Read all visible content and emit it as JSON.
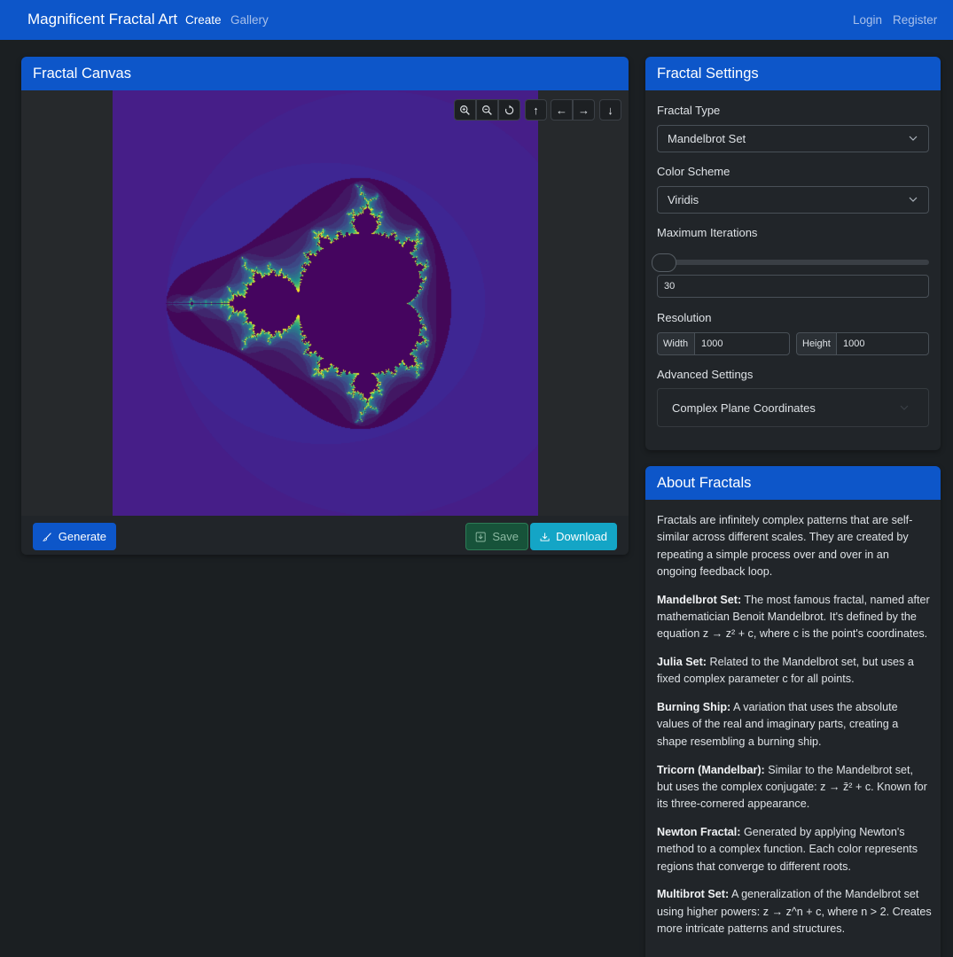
{
  "nav": {
    "brand": "Magnificent Fractal Art",
    "links": [
      {
        "label": "Create",
        "active": true
      },
      {
        "label": "Gallery",
        "active": false
      }
    ],
    "login": "Login",
    "register": "Register"
  },
  "canvas_card": {
    "title": "Fractal Canvas",
    "toolbar_icons": [
      "zoom-in-icon",
      "zoom-out-icon",
      "reset-icon",
      "arrow-up-icon",
      "arrow-left-icon",
      "arrow-right-icon",
      "arrow-down-icon"
    ],
    "toolbar_glyphs": {
      "up": "↑",
      "left": "←",
      "right": "→",
      "down": "↓"
    },
    "footer": {
      "generate_label": "Generate",
      "save_label": "Save",
      "download_label": "Download"
    }
  },
  "settings": {
    "title": "Fractal Settings",
    "fractal_type_label": "Fractal Type",
    "fractal_type_value": "Mandelbrot Set",
    "color_scheme_label": "Color Scheme",
    "color_scheme_value": "Viridis",
    "iterations_label": "Maximum Iterations",
    "iterations_value": "30",
    "iterations_slider_fraction": 0.0,
    "resolution_label": "Resolution",
    "width_label": "Width",
    "width_value": "1000",
    "height_label": "Height",
    "height_value": "1000",
    "advanced_label": "Advanced Settings",
    "accordion_label": "Complex Plane Coordinates"
  },
  "about": {
    "title": "About Fractals",
    "intro": "Fractals are infinitely complex patterns that are self-similar across different scales. They are created by repeating a simple process over and over in an ongoing feedback loop.",
    "entries": [
      {
        "term": "Mandelbrot Set:",
        "text": " The most famous fractal, named after mathematician Benoit Mandelbrot. It's defined by the equation z → z² + c, where c is the point's coordinates."
      },
      {
        "term": "Julia Set:",
        "text": " Related to the Mandelbrot set, but uses a fixed complex parameter c for all points."
      },
      {
        "term": "Burning Ship:",
        "text": " A variation that uses the absolute values of the real and imaginary parts, creating a shape resembling a burning ship."
      },
      {
        "term": "Tricorn (Mandelbar):",
        "text": " Similar to the Mandelbrot set, but uses the complex conjugate: z → z̄² + c. Known for its three-cornered appearance."
      },
      {
        "term": "Newton Fractal:",
        "text": " Generated by applying Newton's method to a complex function. Each color represents regions that converge to different roots."
      },
      {
        "term": "Multibrot Set:",
        "text": " A generalization of the Mandelbrot set using higher powers: z → z^n + c, where n > 2. Creates more intricate patterns and structures."
      }
    ]
  },
  "colors": {
    "navbar": "#0d56c9",
    "page_bg": "#1b1f22",
    "card_bg": "#212529",
    "fractal_outside": "#4a1a82",
    "fractal_inside": "#45055f"
  }
}
